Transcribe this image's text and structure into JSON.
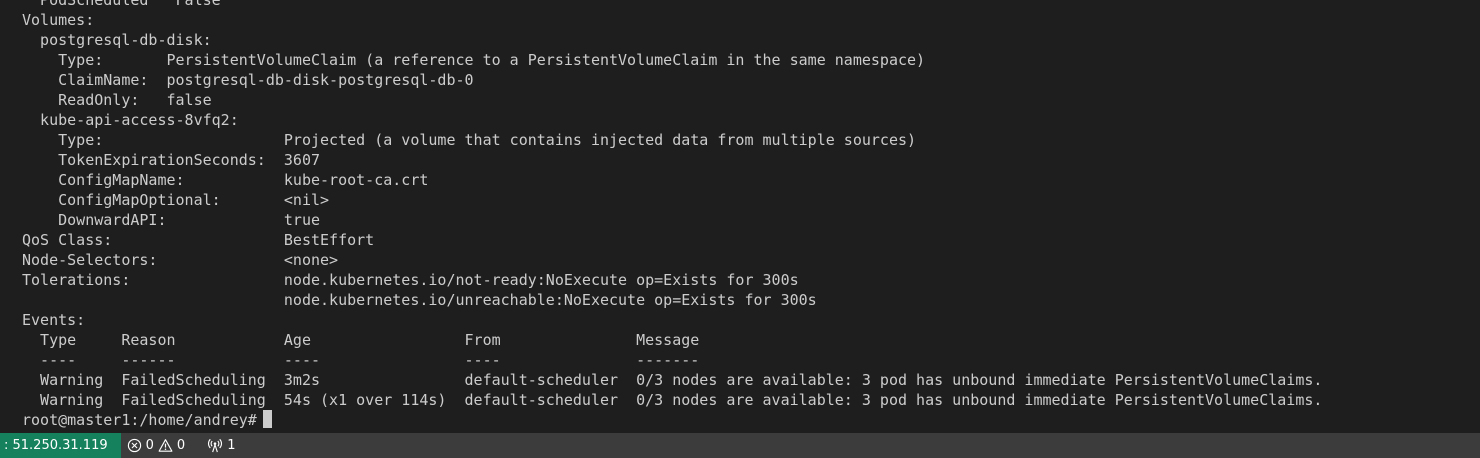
{
  "terminal": {
    "lines": [
      "  PodScheduled   False",
      "Volumes:",
      "  postgresql-db-disk:",
      "    Type:       PersistentVolumeClaim (a reference to a PersistentVolumeClaim in the same namespace)",
      "    ClaimName:  postgresql-db-disk-postgresql-db-0",
      "    ReadOnly:   false",
      "  kube-api-access-8vfq2:",
      "    Type:                    Projected (a volume that contains injected data from multiple sources)",
      "    TokenExpirationSeconds:  3607",
      "    ConfigMapName:           kube-root-ca.crt",
      "    ConfigMapOptional:       <nil>",
      "    DownwardAPI:             true",
      "QoS Class:                   BestEffort",
      "Node-Selectors:              <none>",
      "Tolerations:                 node.kubernetes.io/not-ready:NoExecute op=Exists for 300s",
      "                             node.kubernetes.io/unreachable:NoExecute op=Exists for 300s",
      "Events:",
      "  Type     Reason            Age                 From               Message",
      "  ----     ------            ----                ----               -------",
      "  Warning  FailedScheduling  3m2s                default-scheduler  0/3 nodes are available: 3 pod has unbound immediate PersistentVolumeClaims.",
      "  Warning  FailedScheduling  54s (x1 over 114s)  default-scheduler  0/3 nodes are available: 3 pod has unbound immediate PersistentVolumeClaims."
    ],
    "prompt": "root@master1:/home/andrey#",
    "cursor_color": "#cccccc",
    "background": "#1e1e1e",
    "foreground": "#cccccc"
  },
  "status_bar": {
    "remote_host": ": 51.250.31.119",
    "errors_count": "0",
    "warnings_count": "0",
    "ports_count": "1",
    "remote_bg": "#16825d",
    "remote_fg": "#ffffff",
    "background": "#3c3c3c",
    "icons": {
      "errors": "error-circle-icon",
      "warnings": "warning-triangle-icon",
      "ports": "broadcast-antenna-icon"
    }
  }
}
